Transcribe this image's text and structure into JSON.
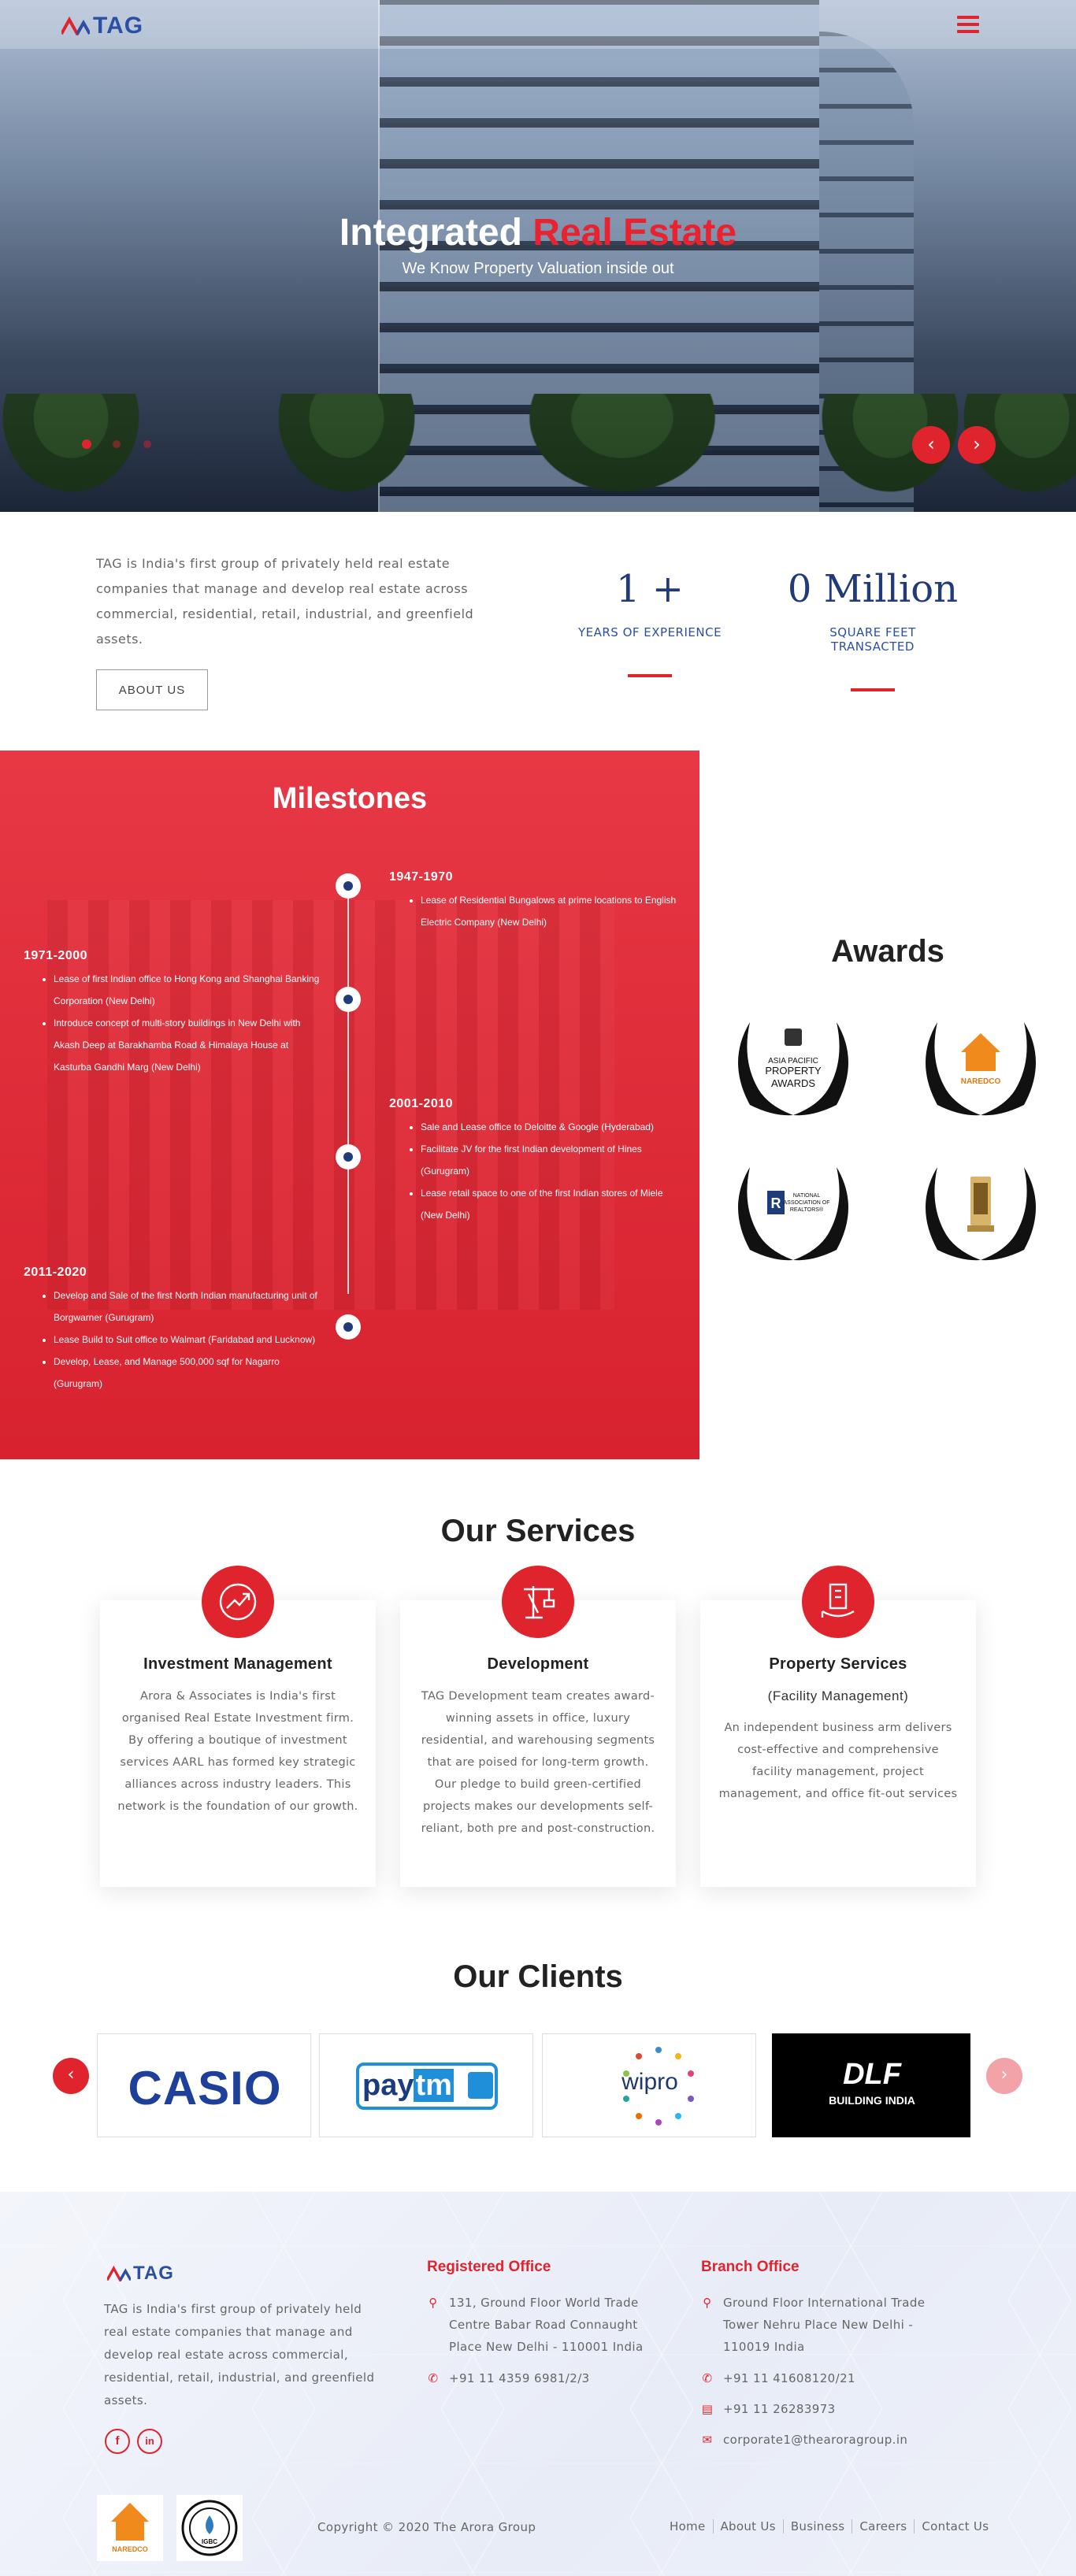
{
  "header": {
    "logo_text": "TAG",
    "menu_icon": "hamburger-icon"
  },
  "hero": {
    "title_white": "Integrated",
    "title_red": "Real Estate",
    "subtitle": "We Know Property Valuation inside out",
    "slides": 3,
    "active_slide": 1,
    "prev_icon": "chevron-left-icon",
    "next_icon": "chevron-right-icon"
  },
  "about": {
    "text": "TAG is India's first group of privately held real estate companies that manage and develop real estate across commercial, residential, retail, industrial, and greenfield assets.",
    "button": "ABOUT US",
    "stats": [
      {
        "value": "1 +",
        "label": "YEARS OF EXPERIENCE"
      },
      {
        "value": "0 Million",
        "label": "SQUARE FEET TRANSACTED"
      }
    ]
  },
  "milestones": {
    "title": "Milestones",
    "items": [
      {
        "year": "1947-1970",
        "points": [
          "Lease of Residential Bungalows at prime locations to English Electric Company (New Delhi)"
        ]
      },
      {
        "year": "1971-2000",
        "points": [
          "Lease of first Indian office to Hong Kong and Shanghai Banking Corporation (New Delhi)",
          "Introduce concept of multi-story buildings in New Delhi with Akash Deep at Barakhamba Road & Himalaya House at Kasturba Gandhi Marg (New Delhi)"
        ]
      },
      {
        "year": "2001-2010",
        "points": [
          "Sale and Lease office to Deloitte & Google (Hyderabad)",
          "Facilitate JV for the first Indian development of Hines (Gurugram)",
          "Lease retail space to one of the first Indian stores of Miele (New Delhi)"
        ]
      },
      {
        "year": "2011-2020",
        "points": [
          "Develop and Sale of the first North Indian manufacturing unit of Borgwarner (Gurugram)",
          "Lease Build to Suit office to Walmart (Faridabad and Lucknow)",
          "Develop, Lease, and Manage 500,000 sqf for Nagarro (Gurugram)"
        ]
      }
    ]
  },
  "awards": {
    "title": "Awards",
    "items": [
      {
        "lines": [
          "ASIA PACIFIC",
          "PROPERTY",
          "AWARDS"
        ],
        "icon": "crest-icon"
      },
      {
        "lines": [
          "NAREDCO"
        ],
        "icon": "house-logo-icon"
      },
      {
        "lines": [
          "NATIONAL",
          "ASSOCIATION OF",
          "REALTORS®"
        ],
        "icon": "realtor-r-icon"
      },
      {
        "lines": [],
        "icon": "trophy-icon"
      }
    ]
  },
  "services": {
    "title": "Our Services",
    "items": [
      {
        "title": "Investment Management",
        "subtitle": "",
        "icon": "growth-chart-icon",
        "text": "Arora & Associates is India's first organised Real Estate Investment firm. By offering a boutique of investment services AARL has formed key strategic alliances across industry leaders. This network is the foundation of our growth."
      },
      {
        "title": "Development",
        "subtitle": "",
        "icon": "crane-icon",
        "text": "TAG Development team creates award-winning assets in office, luxury residential, and warehousing segments that are poised for long-term growth. Our pledge to build green-certified projects makes our developments self-reliant, both pre and post-construction."
      },
      {
        "title": "Property Services",
        "subtitle": "(Facility Management)",
        "icon": "building-hand-icon",
        "text": "An independent business arm delivers cost-effective and comprehensive facility management, project management, and office fit-out services"
      }
    ]
  },
  "clients": {
    "title": "Our Clients",
    "logos": [
      {
        "name": "CASIO"
      },
      {
        "name_a": "pay",
        "name_b": "tm"
      },
      {
        "name": "wipro"
      },
      {
        "name": "DLF",
        "tagline": "BUILDING INDIA"
      }
    ],
    "prev_icon": "chevron-left-icon",
    "next_icon": "chevron-right-icon"
  },
  "footer": {
    "logo_text": "TAG",
    "about": "TAG is India's first group of privately held real estate companies that manage and develop real estate across commercial, residential, retail, industrial, and greenfield assets.",
    "social": [
      {
        "label": "f",
        "icon": "facebook-icon"
      },
      {
        "label": "in",
        "icon": "linkedin-icon"
      }
    ],
    "registered": {
      "title": "Registered Office",
      "address": "131, Ground Floor World Trade Centre Babar Road Connaught Place New Delhi - 110001 India",
      "phone": "+91 11 4359 6981/2/3"
    },
    "branch": {
      "title": "Branch Office",
      "address": "Ground Floor International Trade Tower Nehru Place New Delhi - 110019 India",
      "phone": "+91 11 41608120/21",
      "fax": "+91 11 26283973",
      "email": "corporate1@thearoragroup.in"
    },
    "badges": [
      "NAREDCO",
      "IGBC"
    ],
    "copyright": "Copyright © 2020 The Arora Group",
    "links": [
      "Home",
      "About Us",
      "Business",
      "Careers",
      "Contact Us"
    ]
  },
  "colors": {
    "accent": "#e0242e",
    "brand_blue": "#213a7a"
  }
}
